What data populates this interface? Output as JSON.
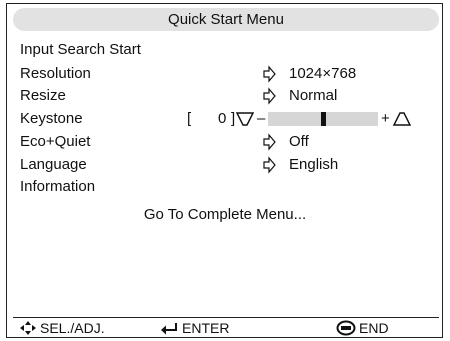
{
  "menu": {
    "title": "Quick Start Menu",
    "items": [
      {
        "label": "Input Search Start"
      },
      {
        "label": "Resolution",
        "value": "1024×768",
        "icon": "right-arrow-icon"
      },
      {
        "label": "Resize",
        "value": "Normal",
        "icon": "right-arrow-icon"
      },
      {
        "label": "Keystone",
        "bracket_open": "[",
        "number": "0",
        "bracket_close": "]",
        "minus": "–",
        "plus": "+",
        "slider_level": 0.5
      },
      {
        "label": "Eco+Quiet",
        "value": "Off",
        "icon": "right-arrow-icon"
      },
      {
        "label": "Language",
        "value": "English",
        "icon": "right-arrow-icon"
      },
      {
        "label": "Information"
      }
    ],
    "goto_label": "Go To Complete Menu..."
  },
  "footer": {
    "sel_adj": "SEL./ADJ.",
    "enter": "ENTER",
    "end": "END",
    "icons": [
      "four-way-arrow-icon",
      "enter-arrow-icon",
      "menu-end-icon"
    ]
  }
}
